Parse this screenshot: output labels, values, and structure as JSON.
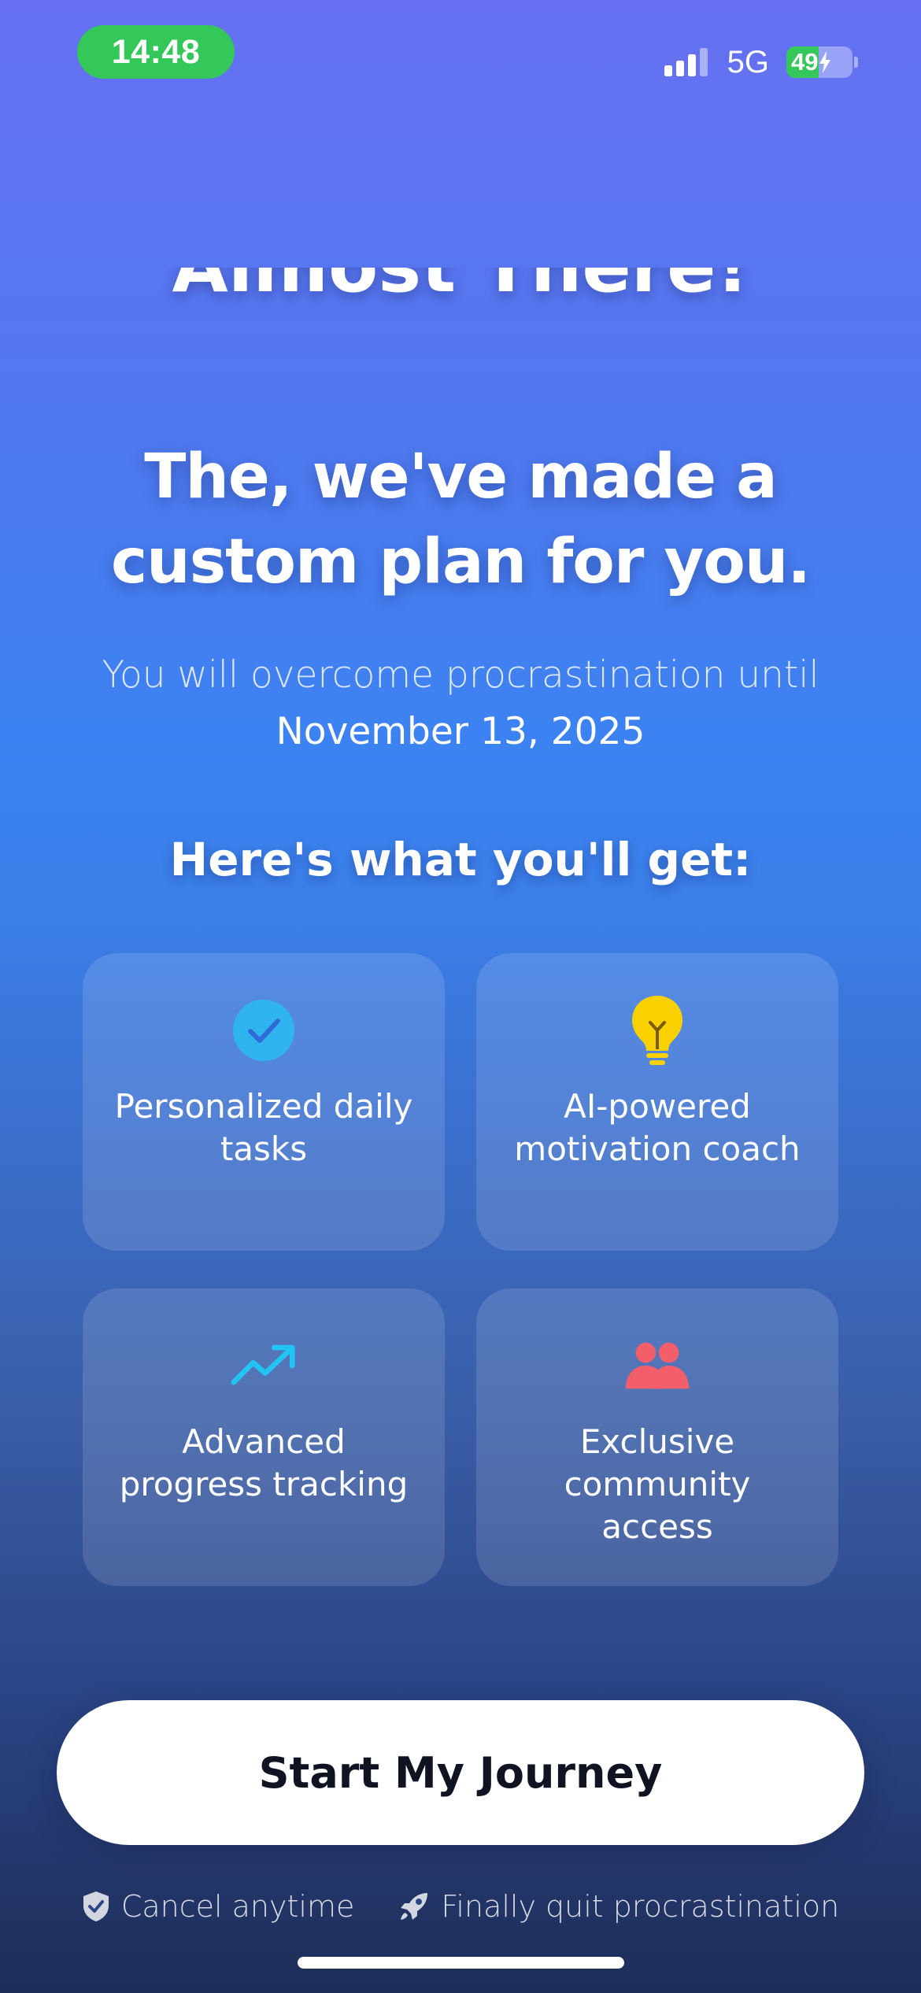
{
  "status_bar": {
    "time": "14:48",
    "network": "5G",
    "battery_percent": "49",
    "battery_level": 0.49
  },
  "header": {
    "partial_title": "Almost There!",
    "plan_title": "The, we've made a custom plan for you.",
    "overcome_text": "You will overcome procrastination until",
    "overcome_date": "November 13, 2025",
    "features_heading": "Here's what you'll get:"
  },
  "features": [
    {
      "icon": "check-circle-icon",
      "label": "Personalized daily tasks"
    },
    {
      "icon": "lightbulb-icon",
      "label": "AI-powered motivation coach"
    },
    {
      "icon": "trending-up-icon",
      "label": "Advanced progress tracking"
    },
    {
      "icon": "users-icon",
      "label": "Exclusive community access"
    }
  ],
  "cta": {
    "label": "Start My Journey"
  },
  "footer": {
    "cancel_label": "Cancel anytime",
    "cancel_icon": "shield-check-icon",
    "quit_label": "Finally quit procrastination",
    "quit_icon": "rocket-icon"
  },
  "colors": {
    "accent_green": "#34c759",
    "check_blue": "#2fb4f0",
    "bulb_yellow": "#fad100",
    "trend_cyan": "#22c4f4",
    "users_red": "#f35e6b",
    "button_text": "#0f1322"
  }
}
